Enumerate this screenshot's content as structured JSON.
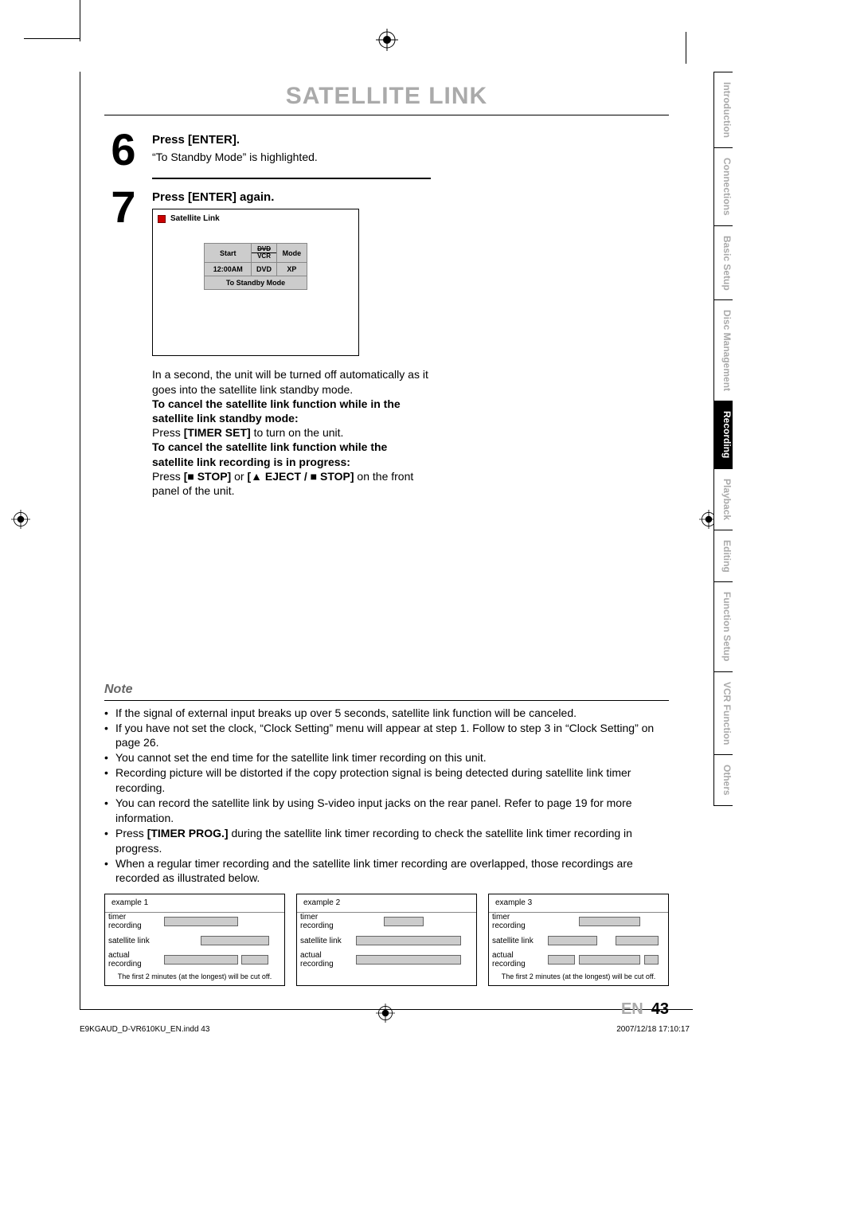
{
  "header": {
    "title": "SATELLITE LINK"
  },
  "steps": {
    "step6": {
      "num": "6",
      "heading": "Press [ENTER].",
      "text": "“To Standby Mode” is highlighted."
    },
    "step7": {
      "num": "7",
      "heading": "Press [ENTER] again.",
      "screen": {
        "title": "Satellite Link",
        "cols": [
          "Start",
          "DVD\nVCR",
          "Mode"
        ],
        "row": [
          "12:00AM",
          "DVD",
          "XP"
        ],
        "standby": "To Standby Mode"
      },
      "para1": "In a second, the unit will be turned off automatically as it goes into the satellite link standby mode.",
      "cancel1_heading": "To cancel the satellite link function while in the satellite link standby mode:",
      "cancel1_text": "Press [TIMER SET] to turn on the unit.",
      "cancel2_heading": "To cancel the satellite link function while the satellite link recording is in progress:",
      "cancel2_text": "Press [■ STOP] or [▲ EJECT / ■ STOP] on the front panel of the unit."
    }
  },
  "tabs": [
    "Introduction",
    "Connections",
    "Basic Setup",
    "Disc Management",
    "Recording",
    "Playback",
    "Editing",
    "Function Setup",
    "VCR Function",
    "Others"
  ],
  "active_tab": "Recording",
  "note": {
    "heading": "Note",
    "items": [
      "If the signal of external input breaks up over 5 seconds, satellite link function will be canceled.",
      "If you have not set the clock, “Clock Setting” menu will appear at step 1. Follow to step 3 in “Clock Setting” on page 26.",
      "You cannot set the end time for the satellite link timer recording on this unit.",
      "Recording picture will be distorted if the copy protection signal is being detected during satellite link timer recording.",
      "You can record the satellite link by using S-video input jacks on the rear panel. Refer to page 19 for more information.",
      "Press [TIMER PROG.] during the satellite link timer recording to check the satellite link timer recording in progress.",
      "When a regular timer recording and the satellite link timer recording are overlapped, those recordings are recorded as illustrated below."
    ],
    "timer_prog_key": "[TIMER PROG.]"
  },
  "diagrams": {
    "rows": [
      "timer recording",
      "satellite link",
      "actual recording"
    ],
    "examples": [
      {
        "title": "example 1",
        "footer": "The first 2 minutes (at the longest) will be cut off."
      },
      {
        "title": "example 2",
        "footer": ""
      },
      {
        "title": "example 3",
        "footer": "The first 2 minutes (at the longest) will be cut off."
      }
    ]
  },
  "pagenum": {
    "lang": "EN",
    "num": "43"
  },
  "print": {
    "file": "E9KGAUD_D-VR610KU_EN.indd   43",
    "timestamp": "2007/12/18   17:10:17"
  }
}
